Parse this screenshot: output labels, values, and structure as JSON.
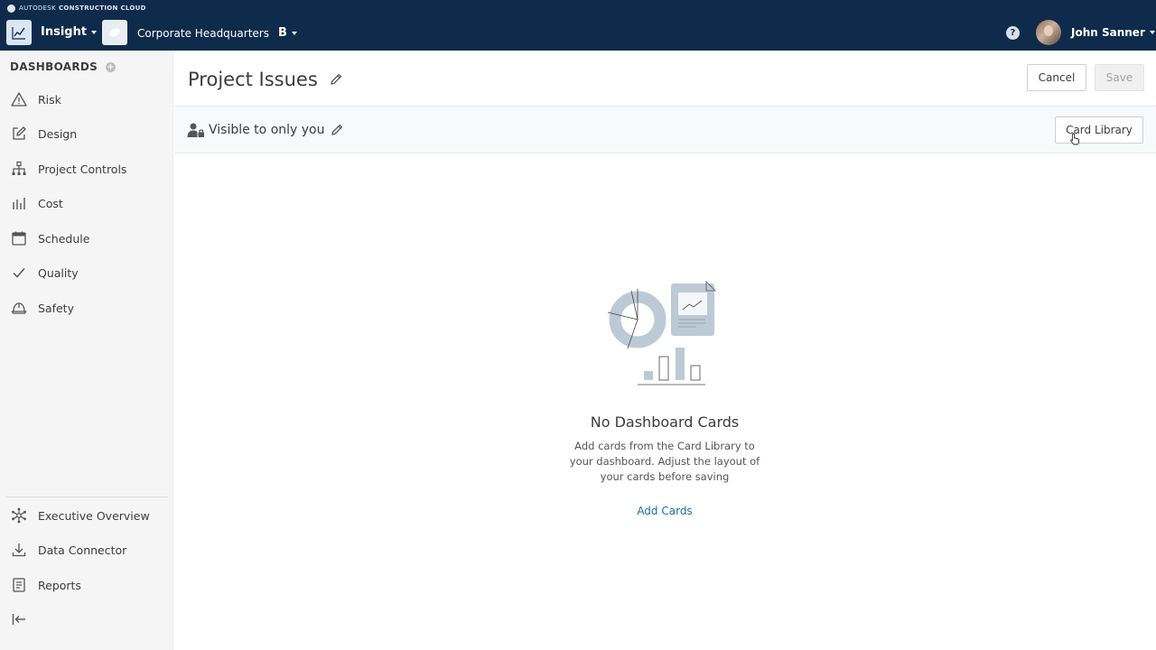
{
  "header": {
    "brand": {
      "autodesk": "AUTODESK",
      "product": "CONSTRUCTION CLOUD"
    },
    "app_name": "Insight",
    "project_name": "Corporate Headquarters",
    "project_mark": "B",
    "help_label": "?",
    "user_name": "John Sanner"
  },
  "sidebar": {
    "title": "DASHBOARDS",
    "add_label": "+",
    "items": [
      {
        "label": "Risk",
        "icon": "warning-icon"
      },
      {
        "label": "Design",
        "icon": "edit-square-icon"
      },
      {
        "label": "Project Controls",
        "icon": "hierarchy-icon"
      },
      {
        "label": "Cost",
        "icon": "bar-chart-icon"
      },
      {
        "label": "Schedule",
        "icon": "calendar-icon"
      },
      {
        "label": "Quality",
        "icon": "checkmark-icon"
      },
      {
        "label": "Safety",
        "icon": "hardhat-icon"
      }
    ],
    "bottom_items": [
      {
        "label": "Executive Overview",
        "icon": "network-icon"
      },
      {
        "label": "Data Connector",
        "icon": "download-icon"
      },
      {
        "label": "Reports",
        "icon": "report-icon"
      }
    ]
  },
  "main": {
    "title": "Project Issues",
    "cancel_label": "Cancel",
    "save_label": "Save",
    "visibility_text": "Visible to only you",
    "card_library_label": "Card Library",
    "empty": {
      "title": "No Dashboard Cards",
      "description": "Add cards from the Card Library to your dashboard. Adjust the layout of your cards before saving",
      "action_label": "Add Cards"
    }
  },
  "colors": {
    "header_bg": "#0f2b4c",
    "link": "#1d6fa5",
    "sidebar_bg": "#f5f5f5",
    "illustration": "#bccad6"
  }
}
